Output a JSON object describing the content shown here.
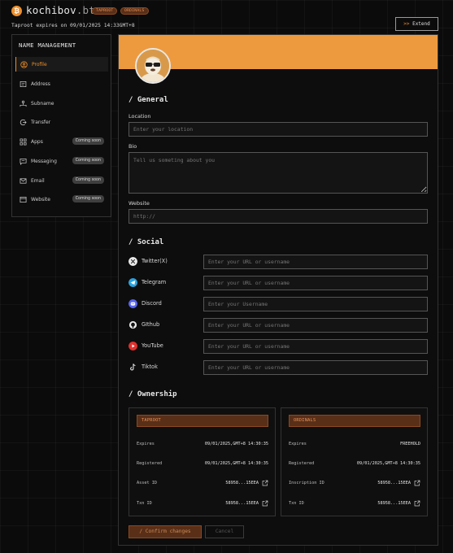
{
  "header": {
    "logo_glyph": "₿",
    "domain_name": "kochibov",
    "domain_tld": ".btc",
    "tags": [
      "TAPROOT",
      "ORDINALS"
    ],
    "expires_note": "Taproot expires on 09/01/2025 14:33GMT+8",
    "extend_arrow": ">>",
    "extend_label": "Extend"
  },
  "sidebar": {
    "title": "NAME MANAGEMENT",
    "items": [
      {
        "label": "Profile",
        "icon": "user-icon",
        "active": true,
        "badge": ""
      },
      {
        "label": "Address",
        "icon": "address-icon",
        "active": false,
        "badge": ""
      },
      {
        "label": "Subname",
        "icon": "subname-icon",
        "active": false,
        "badge": ""
      },
      {
        "label": "Transfer",
        "icon": "transfer-icon",
        "active": false,
        "badge": ""
      },
      {
        "label": "Apps",
        "icon": "apps-icon",
        "active": false,
        "badge": "Coming soon"
      },
      {
        "label": "Messaging",
        "icon": "message-icon",
        "active": false,
        "badge": "Coming soon"
      },
      {
        "label": "Email",
        "icon": "mail-icon",
        "active": false,
        "badge": "Coming soon"
      },
      {
        "label": "Website",
        "icon": "browser-icon",
        "active": false,
        "badge": "Coming soon"
      }
    ]
  },
  "general": {
    "title": "/ General",
    "location_label": "Location",
    "location_placeholder": "Enter your location",
    "bio_label": "Bio",
    "bio_placeholder": "Tell us someting about you",
    "website_label": "Website",
    "website_placeholder": "http://"
  },
  "social": {
    "title": "/ Social",
    "items": [
      {
        "name": "Twitter(X)",
        "icon": "x-icon",
        "placeholder": "Enter your URL or username",
        "color": "#e8e8e8"
      },
      {
        "name": "Telegram",
        "icon": "telegram-icon",
        "placeholder": "Enter your URL or username",
        "color": "#2aa3e0"
      },
      {
        "name": "Discord",
        "icon": "discord-icon",
        "placeholder": "Enter your Username",
        "color": "#5865f2"
      },
      {
        "name": "GIthub",
        "icon": "github-icon",
        "placeholder": "Enter your URL or username",
        "color": "#e8e8e8"
      },
      {
        "name": "YouTube",
        "icon": "youtube-icon",
        "placeholder": "Enter your URL or username",
        "color": "#e0312e"
      },
      {
        "name": "Tiktok",
        "icon": "tiktok-icon",
        "placeholder": "Enter your URL or username",
        "color": "#e8e8e8"
      }
    ]
  },
  "ownership": {
    "title": "/ Ownership",
    "cards": [
      {
        "header": "TAPROOT",
        "rows": [
          {
            "key": "Expires",
            "value": "09/01/2025,GMT+8 14:30:35",
            "link": false
          },
          {
            "key": "Registered",
            "value": "09/01/2025,GMT+8 14:30:35",
            "link": false
          },
          {
            "key": "Asset ID",
            "value": "58958...15EEA",
            "link": true
          },
          {
            "key": "Txn ID",
            "value": "58958...15EEA",
            "link": true
          }
        ]
      },
      {
        "header": "ORDINALS",
        "rows": [
          {
            "key": "Expires",
            "value": "FREEHOLD",
            "link": false
          },
          {
            "key": "Registered",
            "value": "09/01/2025,GMT+8 14:30:35",
            "link": false
          },
          {
            "key": "Inscription ID",
            "value": "58958...15EEA",
            "link": true
          },
          {
            "key": "Txn ID",
            "value": "58958...15EEA",
            "link": true
          }
        ]
      }
    ]
  },
  "actions": {
    "confirm_label": "/ Confirm changes",
    "cancel_label": "Cancel"
  },
  "colors": {
    "accent": "#ef8f2a",
    "banner": "#ed9a3f",
    "tag_bg": "#5a2f18"
  }
}
